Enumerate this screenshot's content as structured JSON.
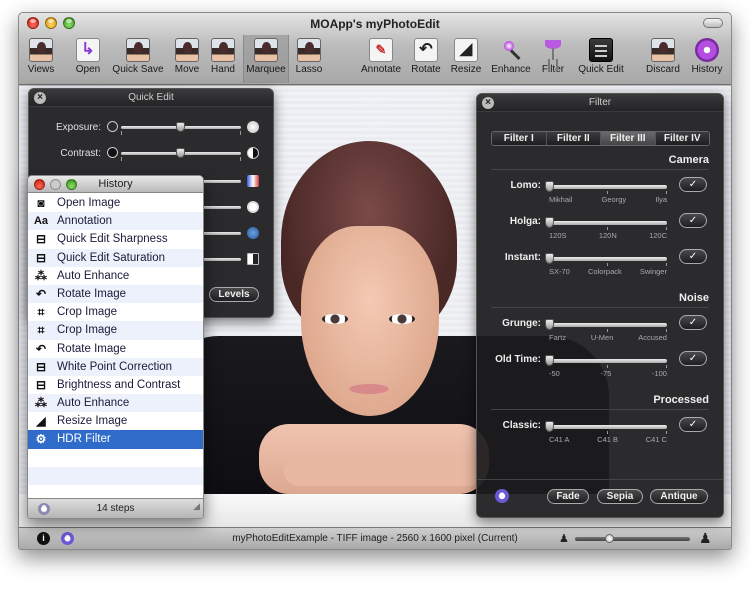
{
  "window": {
    "title": "MOApp's myPhotoEdit"
  },
  "toolbar": {
    "items": [
      {
        "label": "Views",
        "icon": "views-icon"
      },
      {
        "label": "Open",
        "icon": "open-icon"
      },
      {
        "label": "Quick Save",
        "icon": "quick-save-icon"
      },
      {
        "label": "Move",
        "icon": "move-icon"
      },
      {
        "label": "Hand",
        "icon": "hand-icon"
      },
      {
        "label": "Marquee",
        "icon": "marquee-icon",
        "active": true
      },
      {
        "label": "Lasso",
        "icon": "lasso-icon"
      },
      {
        "label": "Annotate",
        "icon": "annotate-icon"
      },
      {
        "label": "Rotate",
        "icon": "rotate-icon"
      },
      {
        "label": "Resize",
        "icon": "resize-icon"
      },
      {
        "label": "Enhance",
        "icon": "enhance-wand-icon"
      },
      {
        "label": "Filter",
        "icon": "filter-glass-icon"
      },
      {
        "label": "Quick Edit",
        "icon": "quick-edit-icon"
      },
      {
        "label": "Discard",
        "icon": "discard-icon"
      },
      {
        "label": "History",
        "icon": "history-icon"
      }
    ]
  },
  "quick_edit": {
    "title": "Quick Edit",
    "sliders": [
      {
        "label": "Exposure:",
        "value": 0.5
      },
      {
        "label": "Contrast:",
        "value": 0.5
      }
    ],
    "levels_button": "Levels"
  },
  "history": {
    "title": "History",
    "items": [
      {
        "label": "Open Image",
        "icon": "camera-icon",
        "glyph": "◙"
      },
      {
        "label": "Annotation",
        "icon": "text-annotation-icon",
        "glyph": "Aa"
      },
      {
        "label": "Quick Edit Sharpness",
        "icon": "quick-edit-icon",
        "glyph": "⊟"
      },
      {
        "label": "Quick Edit Saturation",
        "icon": "quick-edit-icon",
        "glyph": "⊟"
      },
      {
        "label": "Auto Enhance",
        "icon": "magic-wand-icon",
        "glyph": "⁂"
      },
      {
        "label": "Rotate Image",
        "icon": "rotate-icon",
        "glyph": "↶"
      },
      {
        "label": "Crop Image",
        "icon": "crop-icon",
        "glyph": "⌗"
      },
      {
        "label": "Crop Image",
        "icon": "crop-icon",
        "glyph": "⌗"
      },
      {
        "label": "Rotate Image",
        "icon": "rotate-icon",
        "glyph": "↶"
      },
      {
        "label": "White Point Correction",
        "icon": "quick-edit-icon",
        "glyph": "⊟"
      },
      {
        "label": "Brightness and Contrast",
        "icon": "quick-edit-icon",
        "glyph": "⊟"
      },
      {
        "label": "Auto Enhance",
        "icon": "magic-wand-icon",
        "glyph": "⁂"
      },
      {
        "label": "Resize Image",
        "icon": "resize-icon",
        "glyph": "◢"
      },
      {
        "label": "HDR Filter",
        "icon": "hdr-filter-icon",
        "glyph": "⚙",
        "selected": true
      }
    ],
    "footer": "14 steps"
  },
  "filter": {
    "title": "Filter",
    "tabs": [
      {
        "label": "Filter I"
      },
      {
        "label": "Filter II"
      },
      {
        "label": "Filter III",
        "active": true
      },
      {
        "label": "Filter IV"
      }
    ],
    "sections": [
      {
        "heading": "Camera"
      },
      {
        "heading": "Noise"
      },
      {
        "heading": "Processed"
      }
    ],
    "rows": [
      {
        "label": "Lomo:",
        "ticks": [
          "Mikhail",
          "Georgy",
          "Ilya"
        ],
        "value": 0
      },
      {
        "label": "Holga:",
        "ticks": [
          "120S",
          "120N",
          "120C"
        ],
        "value": 0
      },
      {
        "label": "Instant:",
        "ticks": [
          "SX-70",
          "Colorpack",
          "Swinger"
        ],
        "value": 0
      },
      {
        "label": "Grunge:",
        "ticks": [
          "Fartz",
          "U-Men",
          "Accused"
        ],
        "value": 0
      },
      {
        "label": "Old Time:",
        "ticks": [
          "-50",
          "-75",
          "-100"
        ],
        "value": 0
      },
      {
        "label": "Classic:",
        "ticks": [
          "C41 A",
          "C41 B",
          "C41 C"
        ],
        "value": 0
      }
    ],
    "check_glyph": "✓",
    "buttons": {
      "fade": "Fade",
      "sepia": "Sepia",
      "antique": "Antique"
    },
    "help_glyph": "?"
  },
  "status": {
    "text": "myPhotoEditExample - TIFF image - 2560 x 1600 pixel (Current)",
    "zoom_value": 0.3
  }
}
